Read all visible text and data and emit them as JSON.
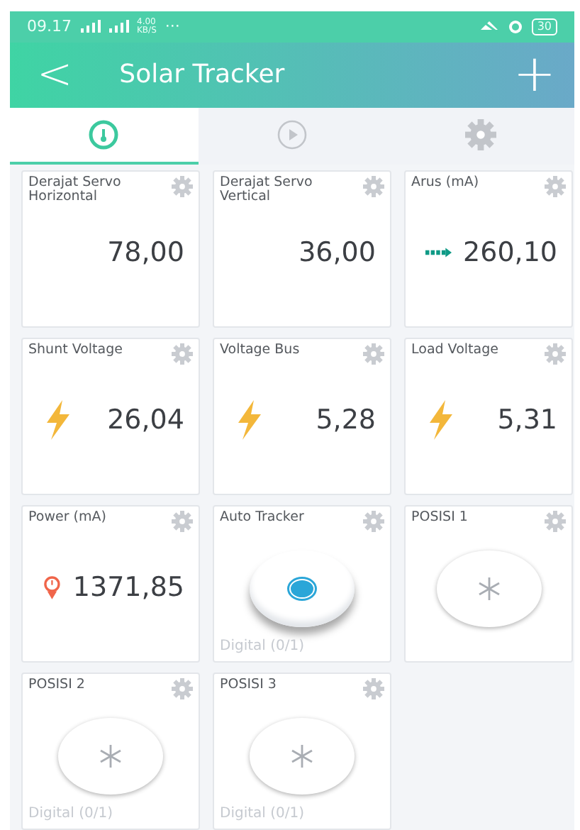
{
  "status_bar": {
    "time": "09.17",
    "net_speed": "4.00",
    "net_unit": "KB/S",
    "more": "···",
    "battery": "30"
  },
  "header": {
    "title": "Solar Tracker",
    "back": "<",
    "add": "+"
  },
  "tabs": [
    {
      "selected": true
    },
    {
      "selected": false
    },
    {
      "selected": false
    }
  ],
  "widgets": [
    {
      "kind": "plain",
      "label": "Derajat Servo Horizontal",
      "value": "78,00"
    },
    {
      "kind": "plain",
      "label": "Derajat Servo Vertical",
      "value": "36,00"
    },
    {
      "kind": "flow",
      "label": "Arus (mA)",
      "value": "260,10"
    },
    {
      "kind": "voltage",
      "label": "Shunt Voltage",
      "value": "26,04"
    },
    {
      "kind": "voltage",
      "label": "Voltage Bus",
      "value": "5,28"
    },
    {
      "kind": "voltage",
      "label": "Load Voltage",
      "value": "5,31"
    },
    {
      "kind": "power",
      "label": "Power (mA)",
      "value": "1371,85"
    },
    {
      "kind": "button",
      "label": "Auto Tracker",
      "on": true,
      "caption": "Digital (0/1)"
    },
    {
      "kind": "button",
      "label": "POSISI 1",
      "on": false
    },
    {
      "kind": "button",
      "label": "POSISI 2",
      "on": false,
      "caption": "Digital (0/1)"
    },
    {
      "kind": "button",
      "label": "POSISI 3",
      "on": false,
      "caption": "Digital (0/1)"
    }
  ]
}
